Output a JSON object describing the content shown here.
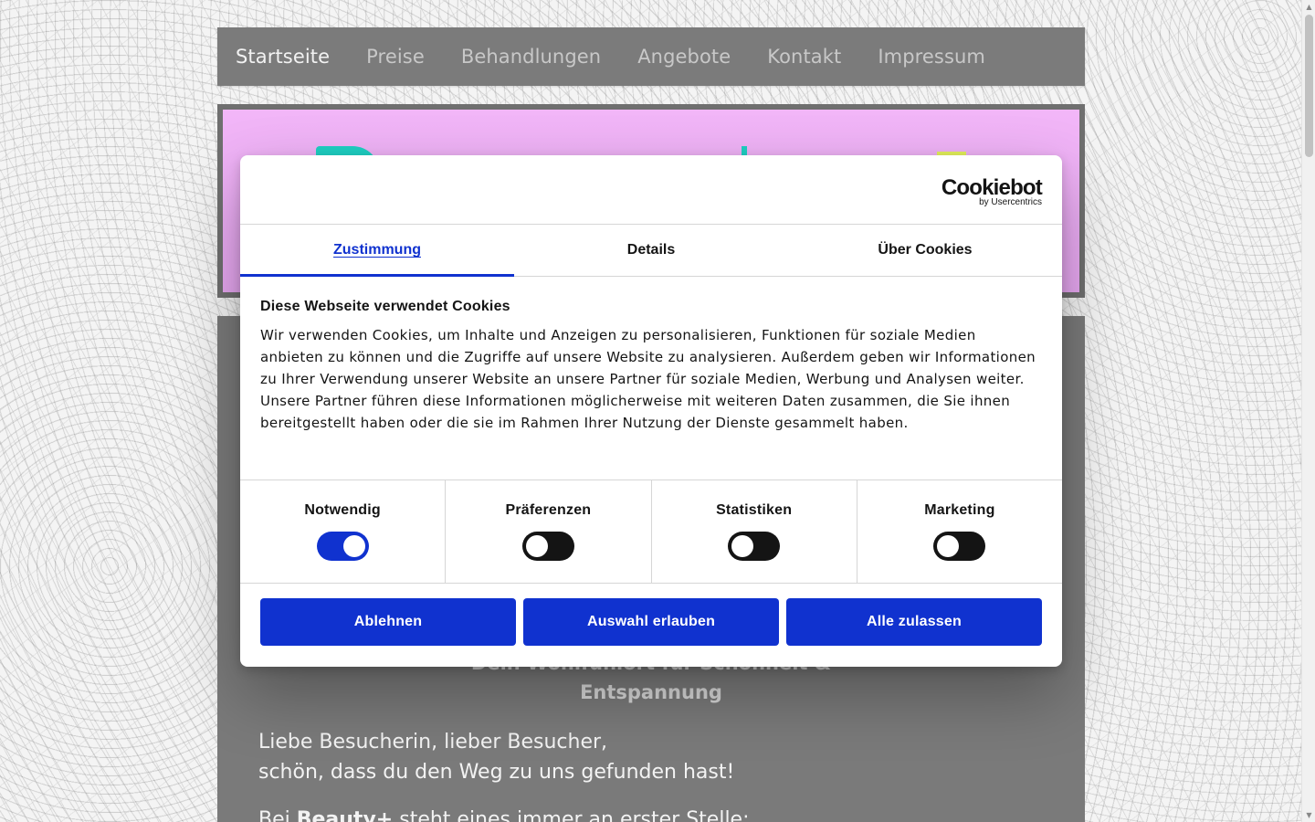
{
  "nav": {
    "items": [
      {
        "label": "Startseite",
        "active": true
      },
      {
        "label": "Preise",
        "active": false
      },
      {
        "label": "Behandlungen",
        "active": false
      },
      {
        "label": "Angebote",
        "active": false
      },
      {
        "label": "Kontakt",
        "active": false
      },
      {
        "label": "Impressum",
        "active": false
      }
    ]
  },
  "content": {
    "subtitle_line1": "Dein Wohlfühlort für Schönheit &",
    "subtitle_line2": "Entspannung",
    "greeting_line1": "Liebe Besucherin, lieber Besucher,",
    "greeting_line2": "schön, dass du den Weg zu uns gefunden hast!",
    "paragraph_start": "Bei ",
    "paragraph_brand": "Beauty+",
    "paragraph_end": " steht eines immer an erster Stelle:"
  },
  "cookie_dialog": {
    "logo_name": "Cookiebot",
    "logo_by": "by Usercentrics",
    "tabs": [
      {
        "label": "Zustimmung",
        "active": true
      },
      {
        "label": "Details",
        "active": false
      },
      {
        "label": "Über Cookies",
        "active": false
      }
    ],
    "title": "Diese Webseite verwendet Cookies",
    "text": "Wir verwenden Cookies, um Inhalte und Anzeigen zu personalisieren, Funktionen für soziale Medien anbieten zu können und die Zugriffe auf unsere Website zu analysieren. Außerdem geben wir Informationen zu Ihrer Verwendung unserer Website an unsere Partner für soziale Medien, Werbung und Analysen weiter. Unsere Partner führen diese Informationen möglicherweise mit weiteren Daten zusammen, die Sie ihnen bereitgestellt haben oder die sie im Rahmen Ihrer Nutzung der Dienste gesammelt haben.",
    "toggles": [
      {
        "label": "Notwendig",
        "on": true
      },
      {
        "label": "Präferenzen",
        "on": false
      },
      {
        "label": "Statistiken",
        "on": false
      },
      {
        "label": "Marketing",
        "on": false
      }
    ],
    "buttons": {
      "decline": "Ablehnen",
      "allow_selection": "Auswahl erlauben",
      "allow_all": "Alle zulassen"
    }
  },
  "colors": {
    "accent": "#1032cf",
    "nav_bg": "#7b7b7b",
    "banner_pink": "#f2b6f8",
    "logo_teal": "#1fd1c4",
    "logo_yellow": "#e6f25c"
  }
}
